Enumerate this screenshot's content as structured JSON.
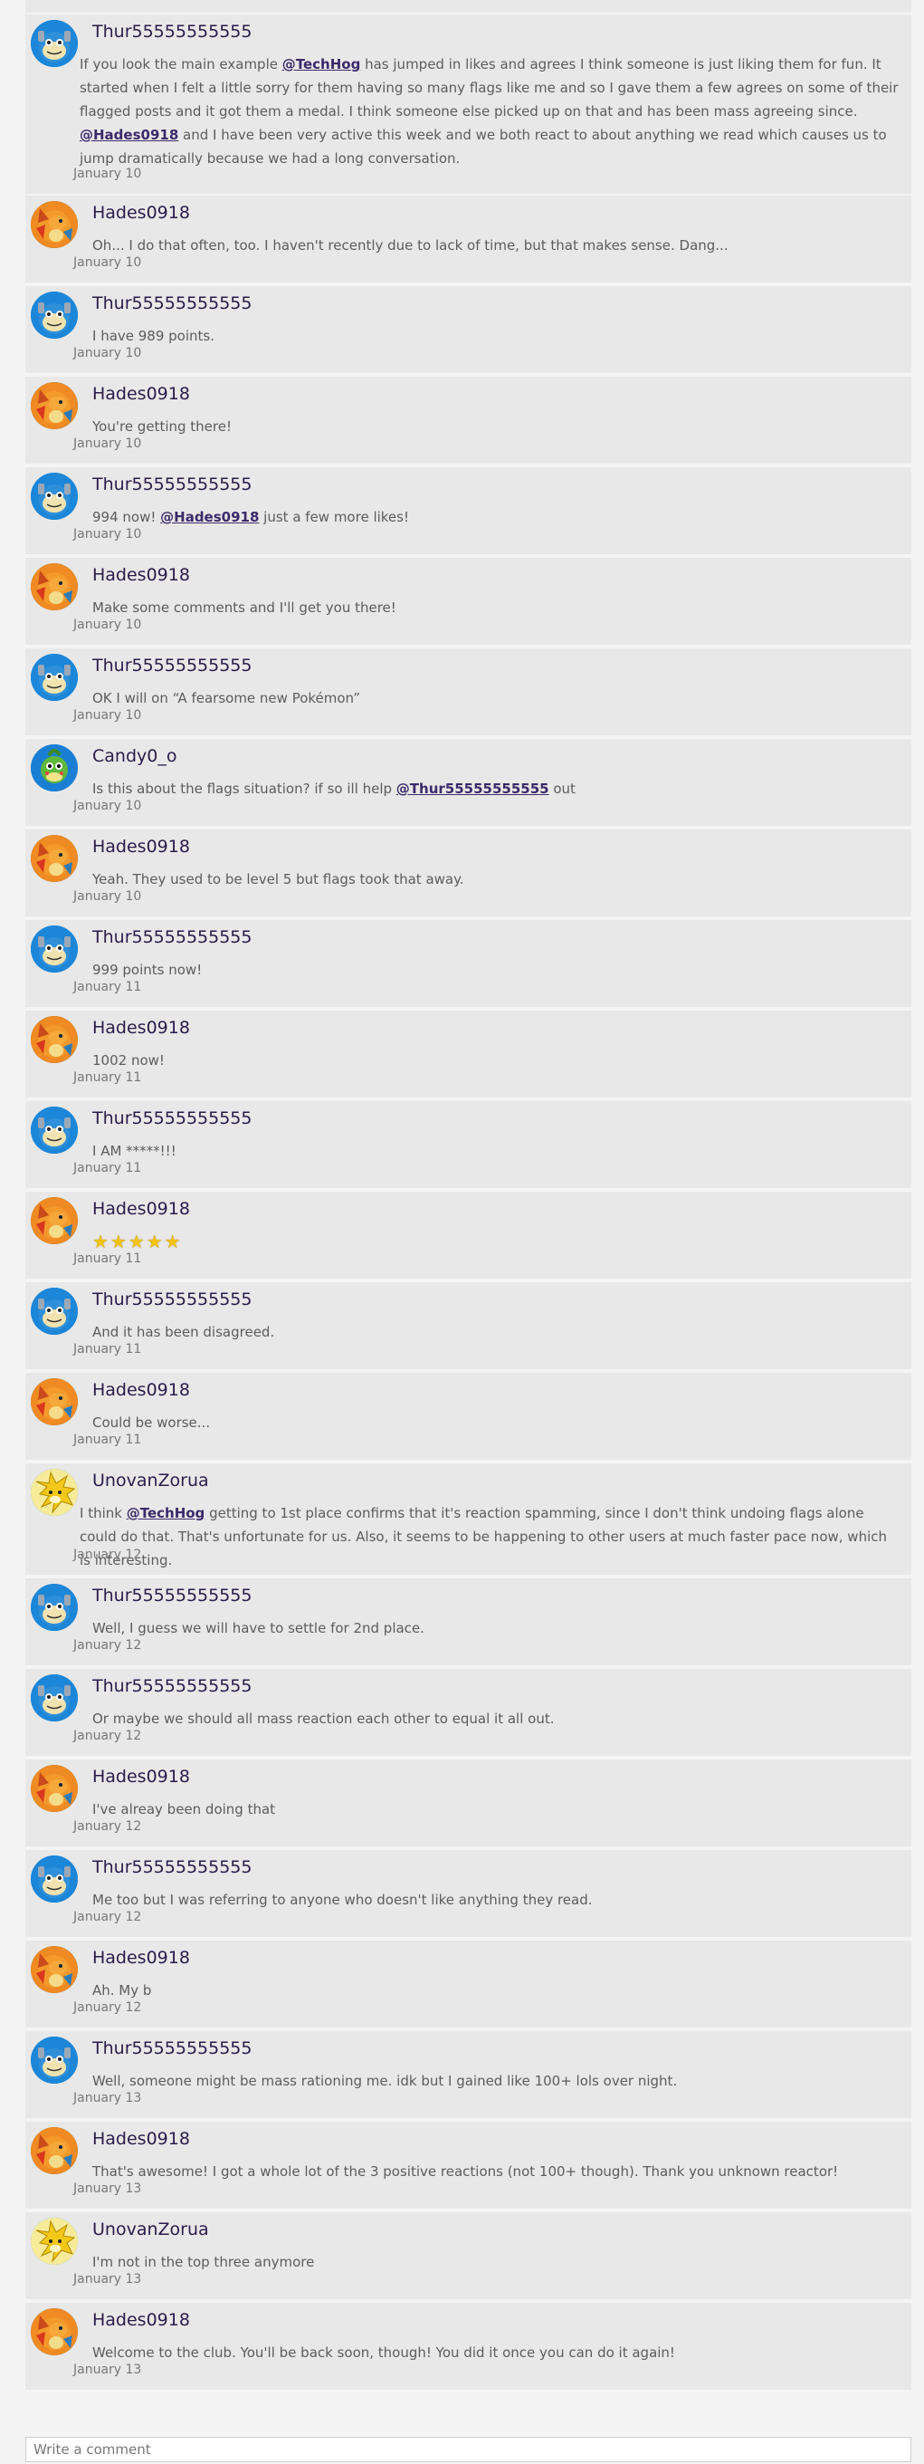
{
  "comments": [
    {
      "author": "Thur55555555555",
      "avatar": "blastoise",
      "segments": [
        {
          "t": "If you look the main example "
        },
        {
          "m": "@TechHog"
        },
        {
          "t": " has jumped in likes and agrees I think someone is just liking them for fun. It started when I felt a little sorry for them having so many flags like me and so I gave them a few agrees on some of their flagged posts and it got them a medal. I think someone else picked up on that and has been mass agreeing since. "
        },
        {
          "m": "@Hades0918"
        },
        {
          "t": " and I have been very active this week and we both react to about anything we read which causes us to jump dramatically because we had a long conversation."
        }
      ],
      "date": "January 10"
    },
    {
      "author": "Hades0918",
      "avatar": "charizard",
      "segments": [
        {
          "t": "Oh... I do that often, too. I haven't recently due to lack of time, but that makes sense. Dang..."
        }
      ],
      "date": "January 10"
    },
    {
      "author": "Thur55555555555",
      "avatar": "blastoise",
      "segments": [
        {
          "t": "I have 989 points."
        }
      ],
      "date": "January 10"
    },
    {
      "author": "Hades0918",
      "avatar": "charizard",
      "segments": [
        {
          "t": "You're getting there!"
        }
      ],
      "date": "January 10"
    },
    {
      "author": "Thur55555555555",
      "avatar": "blastoise",
      "segments": [
        {
          "t": "994 now! "
        },
        {
          "m": "@Hades0918"
        },
        {
          "t": " just a few more likes!"
        }
      ],
      "date": "January 10"
    },
    {
      "author": "Hades0918",
      "avatar": "charizard",
      "segments": [
        {
          "t": "Make some comments and I'll get you there!"
        }
      ],
      "date": "January 10"
    },
    {
      "author": "Thur55555555555",
      "avatar": "blastoise",
      "segments": [
        {
          "t": "OK I will on “A fearsome new Pokémon”"
        }
      ],
      "date": "January 10"
    },
    {
      "author": "Candy0_o",
      "avatar": "politoed",
      "segments": [
        {
          "t": "Is this about the flags situation? if so ill help "
        },
        {
          "m": "@Thur55555555555"
        },
        {
          "t": " out"
        }
      ],
      "date": "January 10"
    },
    {
      "author": "Hades0918",
      "avatar": "charizard",
      "segments": [
        {
          "t": "Yeah. They used to be level 5 but flags took that away."
        }
      ],
      "date": "January 10"
    },
    {
      "author": "Thur55555555555",
      "avatar": "blastoise",
      "segments": [
        {
          "t": "999 points now!"
        }
      ],
      "date": "January 11"
    },
    {
      "author": "Hades0918",
      "avatar": "charizard",
      "segments": [
        {
          "t": "1002 now!"
        }
      ],
      "date": "January 11"
    },
    {
      "author": "Thur55555555555",
      "avatar": "blastoise",
      "segments": [
        {
          "t": "I AM *****!!!"
        }
      ],
      "date": "January 11"
    },
    {
      "author": "Hades0918",
      "avatar": "charizard",
      "segments": [
        {
          "s": "★★★★★"
        }
      ],
      "date": "January 11"
    },
    {
      "author": "Thur55555555555",
      "avatar": "blastoise",
      "segments": [
        {
          "t": "And it has been disagreed."
        }
      ],
      "date": "January 11"
    },
    {
      "author": "Hades0918",
      "avatar": "charizard",
      "segments": [
        {
          "t": "Could be worse..."
        }
      ],
      "date": "January 11"
    },
    {
      "author": "UnovanZorua",
      "avatar": "jolteon",
      "segments": [
        {
          "t": "I think "
        },
        {
          "m": "@TechHog"
        },
        {
          "t": " getting to 1st place confirms that it's reaction spamming, since I don't think undoing flags alone could do that. That's unfortunate for us. Also, it seems to be happening to other users at much faster pace now, which is interesting."
        }
      ],
      "date": "January 12"
    },
    {
      "author": "Thur55555555555",
      "avatar": "blastoise",
      "segments": [
        {
          "t": "Well, I guess we will have to settle for 2nd place."
        }
      ],
      "date": "January 12"
    },
    {
      "author": "Thur55555555555",
      "avatar": "blastoise",
      "segments": [
        {
          "t": "Or maybe we should all mass reaction each other to equal it all out."
        }
      ],
      "date": "January 12"
    },
    {
      "author": "Hades0918",
      "avatar": "charizard",
      "segments": [
        {
          "t": "I've alreay been doing that"
        }
      ],
      "date": "January 12"
    },
    {
      "author": "Thur55555555555",
      "avatar": "blastoise",
      "segments": [
        {
          "t": "Me too but I was referring to anyone who doesn't like anything they read."
        }
      ],
      "date": "January 12"
    },
    {
      "author": "Hades0918",
      "avatar": "charizard",
      "segments": [
        {
          "t": "Ah. My b"
        }
      ],
      "date": "January 12"
    },
    {
      "author": "Thur55555555555",
      "avatar": "blastoise",
      "segments": [
        {
          "t": "Well, someone might be mass rationing me. idk but I gained like 100+ lols over night."
        }
      ],
      "date": "January 13"
    },
    {
      "author": "Hades0918",
      "avatar": "charizard",
      "segments": [
        {
          "t": "That's awesome! I got a whole lot of the 3 positive reactions (not 100+ though). Thank you unknown reactor!"
        }
      ],
      "date": "January 13"
    },
    {
      "author": "UnovanZorua",
      "avatar": "jolteon",
      "segments": [
        {
          "t": "I'm not in the top three anymore"
        }
      ],
      "date": "January 13"
    },
    {
      "author": "Hades0918",
      "avatar": "charizard",
      "segments": [
        {
          "t": "Welcome to the club. You'll be back soon, though! You did it once you can do it again!"
        }
      ],
      "date": "January 13"
    }
  ],
  "comment_input": {
    "placeholder": "Write a comment"
  }
}
